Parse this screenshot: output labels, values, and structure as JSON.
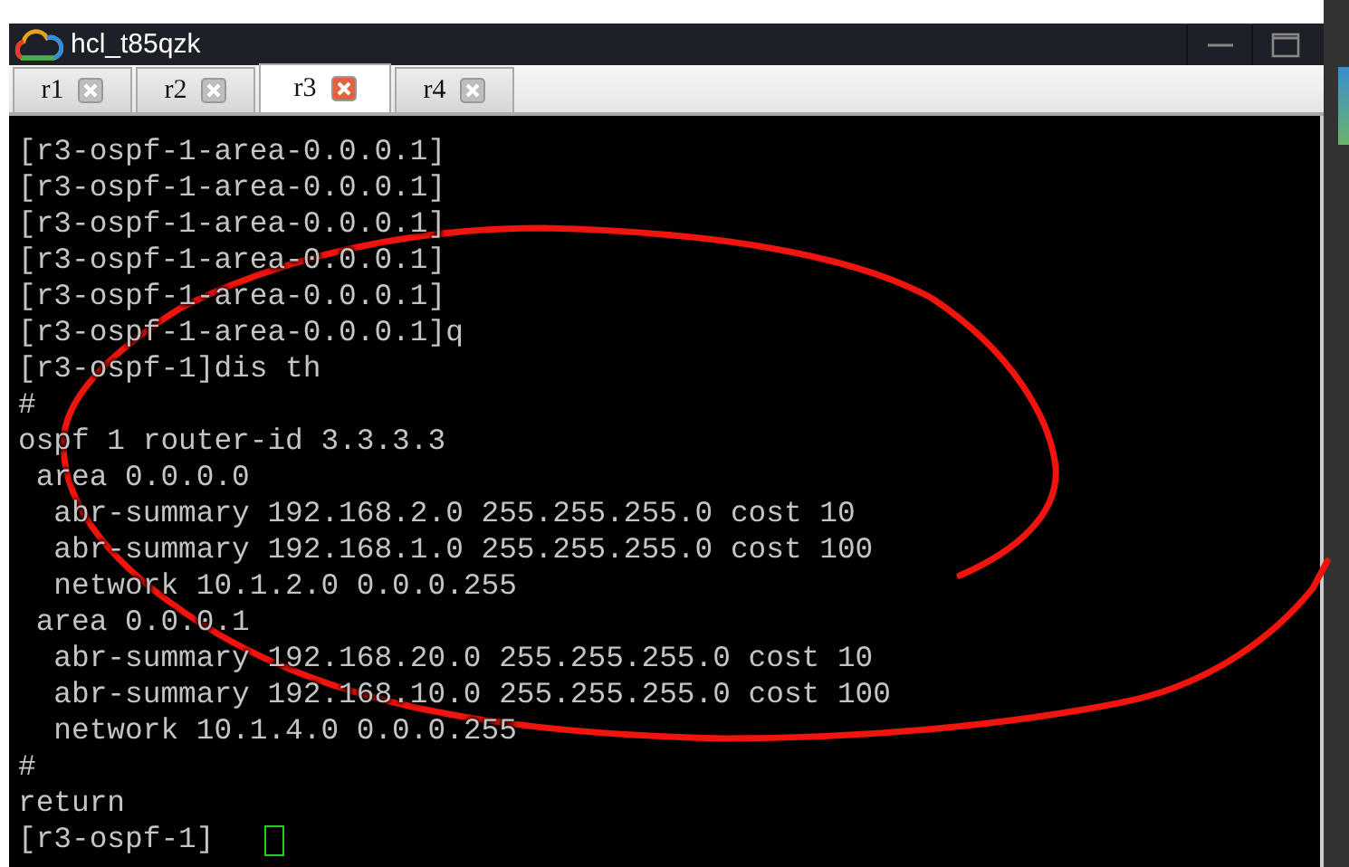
{
  "window": {
    "title": "hcl_t85qzk"
  },
  "tabs": [
    {
      "label": "r1",
      "selected": false
    },
    {
      "label": "r2",
      "selected": false
    },
    {
      "label": "r3",
      "selected": true
    },
    {
      "label": "r4",
      "selected": false
    }
  ],
  "terminal": {
    "lines": [
      "[r3-ospf-1-area-0.0.0.1]",
      "[r3-ospf-1-area-0.0.0.1]",
      "[r3-ospf-1-area-0.0.0.1]",
      "[r3-ospf-1-area-0.0.0.1]",
      "[r3-ospf-1-area-0.0.0.1]",
      "[r3-ospf-1-area-0.0.0.1]q",
      "[r3-ospf-1]dis th",
      "#",
      "ospf 1 router-id 3.3.3.3",
      " area 0.0.0.0",
      "  abr-summary 192.168.2.0 255.255.255.0 cost 10",
      "  abr-summary 192.168.1.0 255.255.255.0 cost 100",
      "  network 10.1.2.0 0.0.0.255",
      " area 0.0.0.1",
      "  abr-summary 192.168.20.0 255.255.255.0 cost 10",
      "  abr-summary 192.168.10.0 255.255.255.0 cost 100",
      "  network 10.1.4.0 0.0.0.255",
      "#",
      "return"
    ],
    "prompt": "[r3-ospf-1]"
  }
}
